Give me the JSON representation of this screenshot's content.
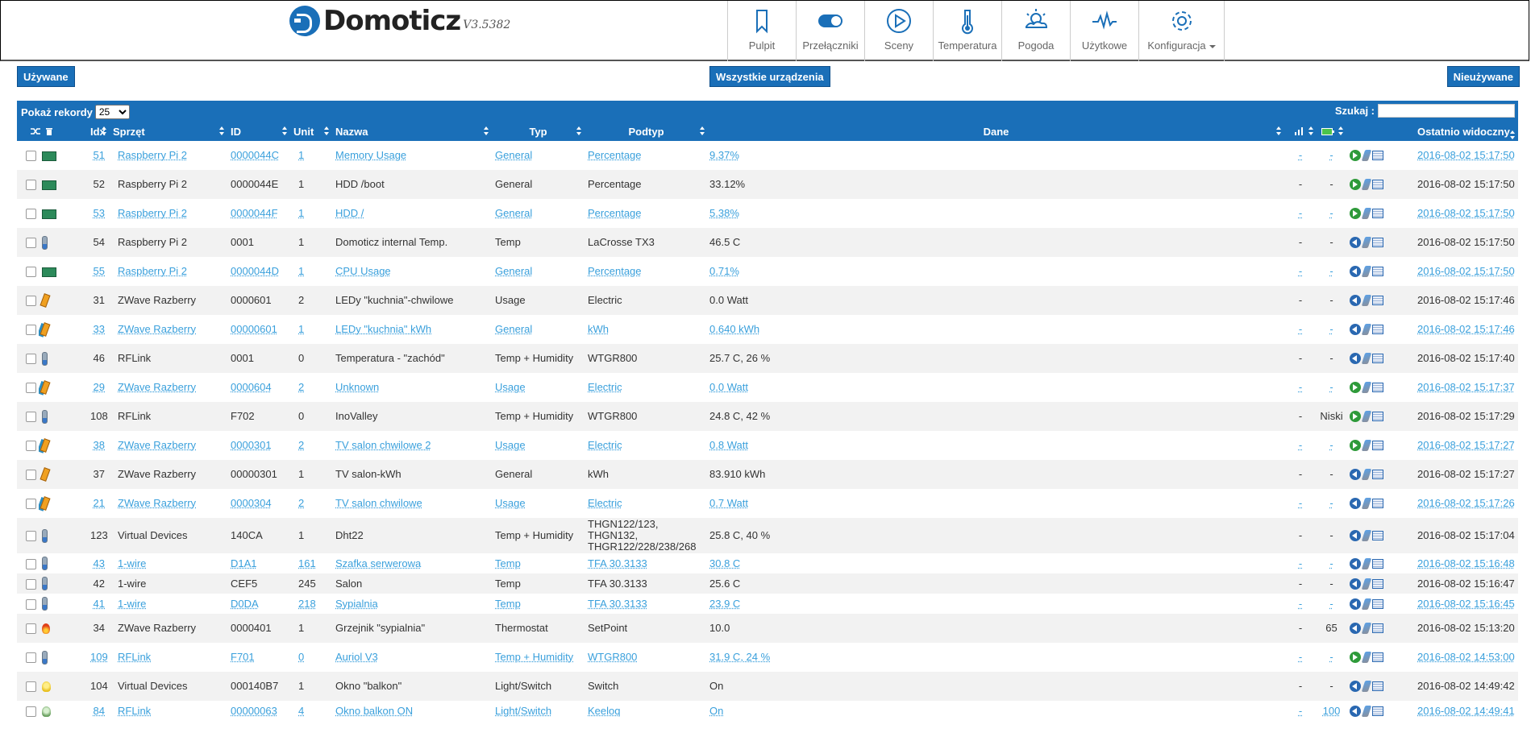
{
  "app": {
    "name": "Domoticz",
    "version": "V3.5382"
  },
  "nav": [
    {
      "label": "Pulpit",
      "icon": "bookmark-icon"
    },
    {
      "label": "Przełączniki",
      "icon": "toggle-icon"
    },
    {
      "label": "Sceny",
      "icon": "play-circle-icon"
    },
    {
      "label": "Temperatura",
      "icon": "thermometer-icon"
    },
    {
      "label": "Pogoda",
      "icon": "weather-icon"
    },
    {
      "label": "Użytkowe",
      "icon": "pulse-icon"
    },
    {
      "label": "Konfiguracja",
      "icon": "gear-icon"
    }
  ],
  "filters": {
    "used": "Używane",
    "all": "Wszystkie urządzenia",
    "unused": "Nieużywane"
  },
  "table_controls": {
    "show_label": "Pokaż rekordy",
    "page_size": "25",
    "search_label": "Szukaj :"
  },
  "columns": {
    "idx": "Idx",
    "hardware": "Sprzęt",
    "id": "ID",
    "unit": "Unit",
    "name": "Nazwa",
    "type": "Typ",
    "subtype": "Podtyp",
    "data": "Dane",
    "last_seen": "Ostatnio widoczny"
  },
  "colors": {
    "primary": "#1a6fb8",
    "link": "#3aa0dc",
    "row_alt": "#f2f2f2"
  },
  "rows": [
    {
      "idx": "51",
      "hw": "Raspberry Pi 2",
      "id": "0000044C",
      "unit": "1",
      "name": "Memory Usage",
      "type": "General",
      "subtype": "Percentage",
      "data": "9.37%",
      "sig": "-",
      "bat": "-",
      "last": "2016-08-02 15:17:50",
      "icon": "chip",
      "go": "g",
      "blue": true
    },
    {
      "idx": "52",
      "hw": "Raspberry Pi 2",
      "id": "0000044E",
      "unit": "1",
      "name": "HDD /boot",
      "type": "General",
      "subtype": "Percentage",
      "data": "33.12%",
      "sig": "-",
      "bat": "-",
      "last": "2016-08-02 15:17:50",
      "icon": "chip",
      "go": "g",
      "blue": false
    },
    {
      "idx": "53",
      "hw": "Raspberry Pi 2",
      "id": "0000044F",
      "unit": "1",
      "name": "HDD /",
      "type": "General",
      "subtype": "Percentage",
      "data": "5.38%",
      "sig": "-",
      "bat": "-",
      "last": "2016-08-02 15:17:50",
      "icon": "chip",
      "go": "g",
      "blue": true
    },
    {
      "idx": "54",
      "hw": "Raspberry Pi 2",
      "id": "0001",
      "unit": "1",
      "name": "Domoticz internal Temp.",
      "type": "Temp",
      "subtype": "LaCrosse TX3",
      "data": "46.5 C",
      "sig": "-",
      "bat": "-",
      "last": "2016-08-02 15:17:50",
      "icon": "therm",
      "go": "b",
      "blue": false
    },
    {
      "idx": "55",
      "hw": "Raspberry Pi 2",
      "id": "0000044D",
      "unit": "1",
      "name": "CPU Usage",
      "type": "General",
      "subtype": "Percentage",
      "data": "0.71%",
      "sig": "-",
      "bat": "-",
      "last": "2016-08-02 15:17:50",
      "icon": "chip",
      "go": "b",
      "blue": true
    },
    {
      "idx": "31",
      "hw": "ZWave Razberry",
      "id": "0000601",
      "unit": "2",
      "name": "LEDy \"kuchnia\"-chwilowe",
      "type": "Usage",
      "subtype": "Electric",
      "data": "0.0 Watt",
      "sig": "-",
      "bat": "-",
      "last": "2016-08-02 15:17:46",
      "icon": "usage",
      "go": "b",
      "blue": false
    },
    {
      "idx": "33",
      "hw": "ZWave Razberry",
      "id": "00000601",
      "unit": "1",
      "name": "LEDy \"kuchnia\" kWh",
      "type": "General",
      "subtype": "kWh",
      "data": "0.640 kWh",
      "sig": "-",
      "bat": "-",
      "last": "2016-08-02 15:17:46",
      "icon": "energy",
      "go": "b",
      "blue": true
    },
    {
      "idx": "46",
      "hw": "RFLink",
      "id": "0001",
      "unit": "0",
      "name": "Temperatura - \"zachód\"",
      "type": "Temp + Humidity",
      "subtype": "WTGR800",
      "data": "25.7 C, 26 %",
      "sig": "-",
      "bat": "-",
      "last": "2016-08-02 15:17:40",
      "icon": "therm",
      "go": "b",
      "blue": false
    },
    {
      "idx": "29",
      "hw": "ZWave Razberry",
      "id": "0000604",
      "unit": "2",
      "name": "Unknown",
      "type": "Usage",
      "subtype": "Electric",
      "data": "0.0 Watt",
      "sig": "-",
      "bat": "-",
      "last": "2016-08-02 15:17:37",
      "icon": "energy",
      "go": "g",
      "blue": true
    },
    {
      "idx": "108",
      "hw": "RFLink",
      "id": "F702",
      "unit": "0",
      "name": "InoValley",
      "type": "Temp + Humidity",
      "subtype": "WTGR800",
      "data": "24.8 C, 42 %",
      "sig": "-",
      "bat": "Niski",
      "last": "2016-08-02 15:17:29",
      "icon": "therm",
      "go": "g",
      "blue": false
    },
    {
      "idx": "38",
      "hw": "ZWave Razberry",
      "id": "0000301",
      "unit": "2",
      "name": "TV salon chwilowe 2",
      "type": "Usage",
      "subtype": "Electric",
      "data": "0.8 Watt",
      "sig": "-",
      "bat": "-",
      "last": "2016-08-02 15:17:27",
      "icon": "energy",
      "go": "g",
      "blue": true
    },
    {
      "idx": "37",
      "hw": "ZWave Razberry",
      "id": "00000301",
      "unit": "1",
      "name": "TV salon-kWh",
      "type": "General",
      "subtype": "kWh",
      "data": "83.910 kWh",
      "sig": "-",
      "bat": "-",
      "last": "2016-08-02 15:17:27",
      "icon": "usage",
      "go": "b",
      "blue": false
    },
    {
      "idx": "21",
      "hw": "ZWave Razberry",
      "id": "0000304",
      "unit": "2",
      "name": "TV salon chwilowe",
      "type": "Usage",
      "subtype": "Electric",
      "data": "0.7 Watt",
      "sig": "-",
      "bat": "-",
      "last": "2016-08-02 15:17:26",
      "icon": "energy",
      "go": "b",
      "blue": true
    },
    {
      "idx": "123",
      "hw": "Virtual Devices",
      "id": "140CA",
      "unit": "1",
      "name": "Dht22",
      "type": "Temp + Humidity",
      "subtype": "THGN122/123, THGN132, THGR122/228/238/268",
      "data": "25.8 C, 40 %",
      "sig": "-",
      "bat": "-",
      "last": "2016-08-02 15:17:04",
      "icon": "therm",
      "go": "b",
      "blue": false
    },
    {
      "idx": "43",
      "hw": "1-wire",
      "id": "D1A1",
      "unit": "161",
      "name": "Szafka serwerowa",
      "type": "Temp",
      "subtype": "TFA 30.3133",
      "data": "30.8 C",
      "sig": "-",
      "bat": "-",
      "last": "2016-08-02 15:16:48",
      "icon": "therm",
      "go": "b",
      "blue": true
    },
    {
      "idx": "42",
      "hw": "1-wire",
      "id": "CEF5",
      "unit": "245",
      "name": "Salon",
      "type": "Temp",
      "subtype": "TFA 30.3133",
      "data": "25.6 C",
      "sig": "-",
      "bat": "-",
      "last": "2016-08-02 15:16:47",
      "icon": "therm",
      "go": "b",
      "blue": false
    },
    {
      "idx": "41",
      "hw": "1-wire",
      "id": "D0DA",
      "unit": "218",
      "name": "Sypialnia",
      "type": "Temp",
      "subtype": "TFA 30.3133",
      "data": "23.9 C",
      "sig": "-",
      "bat": "-",
      "last": "2016-08-02 15:16:45",
      "icon": "therm",
      "go": "b",
      "blue": true
    },
    {
      "idx": "34",
      "hw": "ZWave Razberry",
      "id": "0000401",
      "unit": "1",
      "name": "Grzejnik \"sypialnia\"",
      "type": "Thermostat",
      "subtype": "SetPoint",
      "data": "10.0",
      "sig": "-",
      "bat": "65",
      "last": "2016-08-02 15:13:20",
      "icon": "flame",
      "go": "b",
      "blue": false
    },
    {
      "idx": "109",
      "hw": "RFLink",
      "id": "F701",
      "unit": "0",
      "name": "Auriol V3",
      "type": "Temp + Humidity",
      "subtype": "WTGR800",
      "data": "31.9 C, 24 %",
      "sig": "-",
      "bat": "-",
      "last": "2016-08-02 14:53:00",
      "icon": "therm",
      "go": "g",
      "blue": true
    },
    {
      "idx": "104",
      "hw": "Virtual Devices",
      "id": "000140B7",
      "unit": "1",
      "name": "Okno \"balkon\"",
      "type": "Light/Switch",
      "subtype": "Switch",
      "data": "On",
      "sig": "-",
      "bat": "-",
      "last": "2016-08-02 14:49:42",
      "icon": "bulb",
      "go": "b",
      "blue": false
    },
    {
      "idx": "84",
      "hw": "RFLink",
      "id": "00000063",
      "unit": "4",
      "name": "Okno balkon ON",
      "type": "Light/Switch",
      "subtype": "Keeloq",
      "data": "On",
      "sig": "-",
      "bat": "100",
      "last": "2016-08-02 14:49:41",
      "icon": "bulb-off",
      "go": "b",
      "blue": true
    }
  ]
}
